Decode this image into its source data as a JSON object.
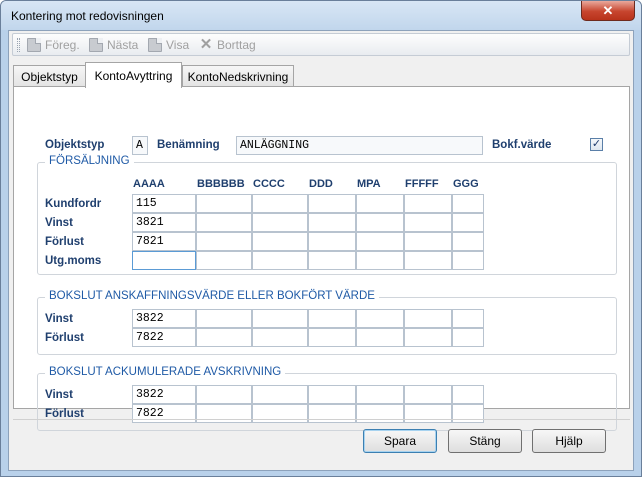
{
  "window": {
    "title": "Kontering mot redovisningen",
    "close_glyph": "✕"
  },
  "toolbar": {
    "items": [
      {
        "label": "Föreg.",
        "icon": "document-icon"
      },
      {
        "label": "Nästa",
        "icon": "document-icon"
      },
      {
        "label": "Visa",
        "icon": "document-icon"
      },
      {
        "label": "Borttag",
        "icon": "delete-icon"
      }
    ]
  },
  "tabs": [
    {
      "label": "Objektstyp",
      "active": false
    },
    {
      "label": "KontoAvyttring",
      "active": true
    },
    {
      "label": "KontoNedskrivning",
      "active": false
    }
  ],
  "header": {
    "objektstyp_label": "Objektstyp",
    "objektstyp_value": "A",
    "benamning_label": "Benämning",
    "benamning_value": "ANLÄGGNING",
    "bokf_label": "Bokf.värde",
    "bokf_checked": true,
    "check_glyph": "✓"
  },
  "columns": [
    "AAAA",
    "BBBBBB",
    "CCCC",
    "DDD",
    "MPA",
    "FFFFF",
    "GGG"
  ],
  "groups": {
    "forsaljning": {
      "title": "FÖRSÄLJNING",
      "rows": [
        {
          "label": "Kundfordr",
          "value": "115"
        },
        {
          "label": "Vinst",
          "value": "3821"
        },
        {
          "label": "Förlust",
          "value": "7821"
        },
        {
          "label": "Utg.moms",
          "value": ""
        }
      ]
    },
    "bokslut_anskaffning": {
      "title": "BOKSLUT ANSKAFFNINGSVÄRDE ELLER BOKFÖRT VÄRDE",
      "rows": [
        {
          "label": "Vinst",
          "value": "3822"
        },
        {
          "label": "Förlust",
          "value": "7822"
        }
      ]
    },
    "bokslut_ackumulerade": {
      "title": "BOKSLUT ACKUMULERADE AVSKRIVNING",
      "rows": [
        {
          "label": "Vinst",
          "value": "3822"
        },
        {
          "label": "Förlust",
          "value": "7822"
        }
      ]
    }
  },
  "buttons": {
    "spara": "Spara",
    "stang": "Stäng",
    "hjalp": "Hjälp"
  }
}
